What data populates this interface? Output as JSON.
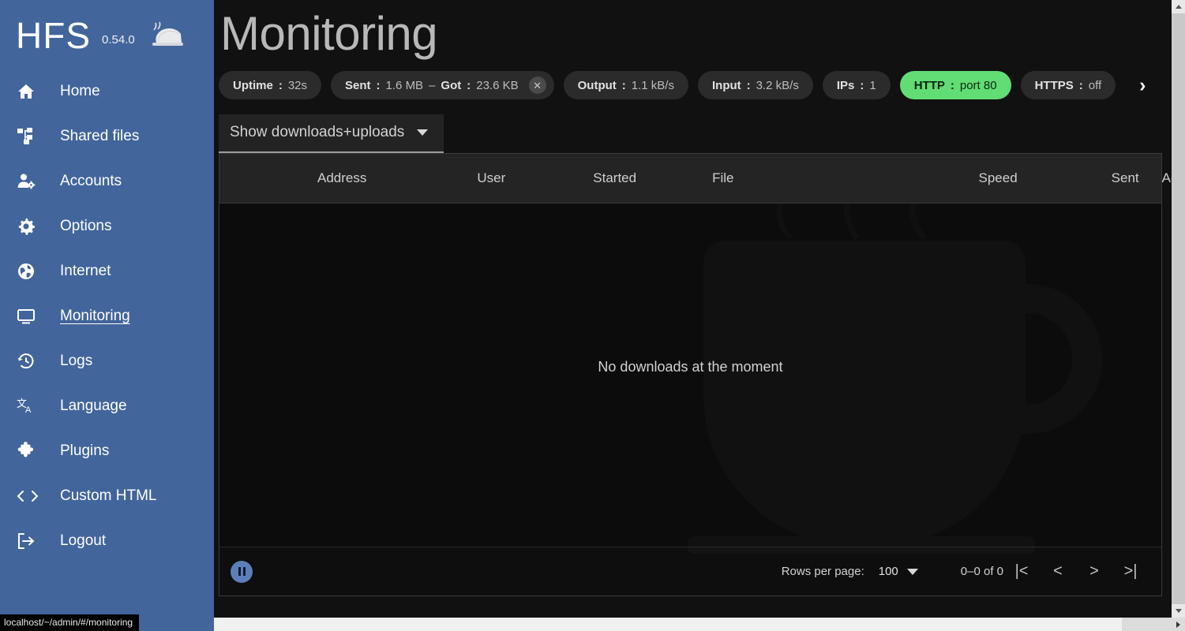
{
  "sidebar": {
    "brand": {
      "name": "HFS",
      "version": "0.54.0",
      "logo_icon": "serving-dish-icon"
    },
    "items": [
      {
        "label": "Home",
        "icon": "home-icon",
        "active": false
      },
      {
        "label": "Shared files",
        "icon": "sitemap-icon",
        "active": false
      },
      {
        "label": "Accounts",
        "icon": "user-gear-icon",
        "active": false
      },
      {
        "label": "Options",
        "icon": "gear-icon",
        "active": false
      },
      {
        "label": "Internet",
        "icon": "globe-icon",
        "active": false
      },
      {
        "label": "Monitoring",
        "icon": "monitor-icon",
        "active": true
      },
      {
        "label": "Logs",
        "icon": "history-icon",
        "active": false
      },
      {
        "label": "Language",
        "icon": "translate-icon",
        "active": false
      },
      {
        "label": "Plugins",
        "icon": "puzzle-icon",
        "active": false
      },
      {
        "label": "Custom HTML",
        "icon": "code-brackets-icon",
        "active": false
      },
      {
        "label": "Logout",
        "icon": "logout-icon",
        "active": false
      }
    ]
  },
  "status_bar": {
    "url": "localhost/~/admin/#/monitoring"
  },
  "main": {
    "title": "Monitoring",
    "chips": [
      {
        "key": "Uptime",
        "value": "32s",
        "style": "dark",
        "closable": false
      },
      {
        "key": "Sent",
        "value": "1.6 MB",
        "key2": "Got",
        "value2": "23.6 KB",
        "style": "dark",
        "closable": true
      },
      {
        "key": "Output",
        "value": "1.1 kB/s",
        "style": "dark",
        "closable": false
      },
      {
        "key": "Input",
        "value": "3.2 kB/s",
        "style": "dark",
        "closable": false
      },
      {
        "key": "IPs",
        "value": "1",
        "style": "dark",
        "closable": false
      },
      {
        "key": "HTTP",
        "value": "port 80",
        "style": "green",
        "closable": false
      },
      {
        "key": "HTTPS",
        "value": "off",
        "style": "dark",
        "closable": false
      }
    ],
    "chips_more_icon": "chevron-right-icon",
    "sent_chip": {
      "sent_key": "Sent",
      "sent_value": "1.6 MB",
      "separator": "–",
      "got_key": "Got",
      "got_value": "23.6 KB",
      "clear_icon": "close-circle-icon"
    },
    "filter_select": {
      "label": "Show downloads+uploads",
      "caret_icon": "chevron-down-icon"
    },
    "table": {
      "columns": [
        "Address",
        "User",
        "Started",
        "File",
        "Speed",
        "Sent",
        "Agent"
      ],
      "rows": [],
      "empty_message": "No downloads at the moment"
    },
    "footer": {
      "pause_icon": "pause-icon",
      "rows_per_page_label": "Rows per page:",
      "rows_per_page_value": "100",
      "rows_per_page_caret": "chevron-down-icon",
      "range_label": "0–0 of 0",
      "first_page_icon": "|<",
      "prev_page_icon": "<",
      "next_page_icon": ">",
      "last_page_icon": ">|"
    }
  },
  "colors": {
    "sidebar_blue": "#42659b",
    "page_bg": "#111111",
    "chip_bg": "#2b2b2b",
    "chip_green": "#62dc74",
    "accent_pause": "#5b80b9",
    "title_text": "#b8b8b8"
  }
}
